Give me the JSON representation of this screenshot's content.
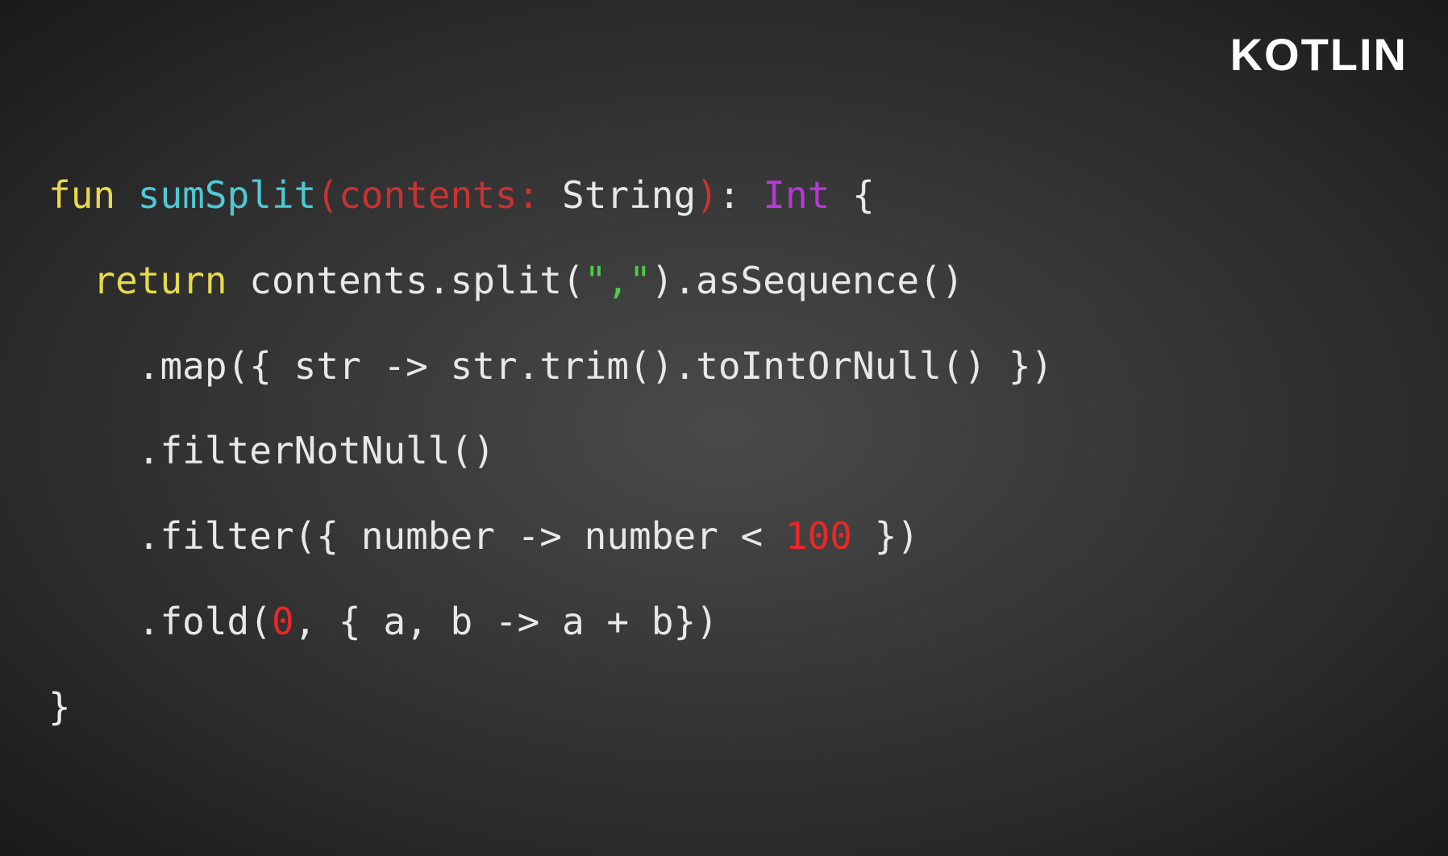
{
  "brand": "KOTLIN",
  "code": {
    "line1": {
      "kw_fun": "fun",
      "space1": " ",
      "funcname": "sumSplit",
      "lparen": "(",
      "param": "contents",
      "colon": ":",
      "space2": " ",
      "type": "String",
      "rparen": ")",
      "colon2": ": ",
      "rettype": "Int",
      "space3": " ",
      "brace": "{"
    },
    "line2": {
      "indent": "  ",
      "kw_return": "return",
      "space": " ",
      "expr": "contents.split(",
      "str": "\",\"",
      "rest": ").asSequence()"
    },
    "line3": {
      "indent": "    ",
      "text": ".map({ str -> str.trim().toIntOrNull() })"
    },
    "line4": {
      "indent": "    ",
      "text": ".filterNotNull()"
    },
    "line5": {
      "indent": "    ",
      "pre": ".filter({ number -> number < ",
      "num": "100",
      "post": " })"
    },
    "line6": {
      "indent": "    ",
      "pre": ".fold(",
      "num": "0",
      "post": ", { a, b -> a + b})"
    },
    "line7": {
      "text": "}"
    }
  }
}
